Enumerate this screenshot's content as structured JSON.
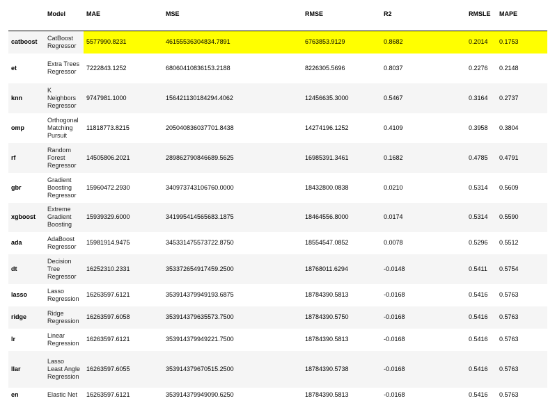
{
  "table": {
    "columns": [
      "",
      "Model",
      "MAE",
      "MSE",
      "RMSE",
      "R2",
      "RMSLE",
      "MAPE"
    ],
    "highlight_color": "#ffff00",
    "rows": [
      {
        "id": "catboost",
        "model": "CatBoost Regressor",
        "mae": "5577990.8231",
        "mse": "46155536304834.7891",
        "rmse": "6763853.9129",
        "r2": "0.8682",
        "rmsle": "0.2014",
        "mape": "0.1753"
      },
      {
        "id": "et",
        "model": "Extra Trees Regressor",
        "mae": "7222843.1252",
        "mse": "68060410836153.2188",
        "rmse": "8226305.5696",
        "r2": "0.8037",
        "rmsle": "0.2276",
        "mape": "0.2148"
      },
      {
        "id": "knn",
        "model": "K Neighbors Regressor",
        "mae": "9747981.1000",
        "mse": "156421130184294.4062",
        "rmse": "12456635.3000",
        "r2": "0.5467",
        "rmsle": "0.3164",
        "mape": "0.2737"
      },
      {
        "id": "omp",
        "model": "Orthogonal Matching Pursuit",
        "mae": "11818773.8215",
        "mse": "205040836037701.8438",
        "rmse": "14274196.1252",
        "r2": "0.4109",
        "rmsle": "0.3958",
        "mape": "0.3804"
      },
      {
        "id": "rf",
        "model": "Random Forest Regressor",
        "mae": "14505806.2021",
        "mse": "289862790846689.5625",
        "rmse": "16985391.3461",
        "r2": "0.1682",
        "rmsle": "0.4785",
        "mape": "0.4791"
      },
      {
        "id": "gbr",
        "model": "Gradient Boosting Regressor",
        "mae": "15960472.2930",
        "mse": "340973743106760.0000",
        "rmse": "18432800.0838",
        "r2": "0.0210",
        "rmsle": "0.5314",
        "mape": "0.5609"
      },
      {
        "id": "xgboost",
        "model": "Extreme Gradient Boosting",
        "mae": "15939329.6000",
        "mse": "341995414565683.1875",
        "rmse": "18464556.8000",
        "r2": "0.0174",
        "rmsle": "0.5314",
        "mape": "0.5590"
      },
      {
        "id": "ada",
        "model": "AdaBoost Regressor",
        "mae": "15981914.9475",
        "mse": "345331475573722.8750",
        "rmse": "18554547.0852",
        "r2": "0.0078",
        "rmsle": "0.5296",
        "mape": "0.5512"
      },
      {
        "id": "dt",
        "model": "Decision Tree Regressor",
        "mae": "16252310.2331",
        "mse": "353372654917459.2500",
        "rmse": "18768011.6294",
        "r2": "-0.0148",
        "rmsle": "0.5411",
        "mape": "0.5754"
      },
      {
        "id": "lasso",
        "model": "Lasso Regression",
        "mae": "16263597.6121",
        "mse": "353914379949193.6875",
        "rmse": "18784390.5813",
        "r2": "-0.0168",
        "rmsle": "0.5416",
        "mape": "0.5763"
      },
      {
        "id": "ridge",
        "model": "Ridge Regression",
        "mae": "16263597.6058",
        "mse": "353914379635573.7500",
        "rmse": "18784390.5750",
        "r2": "-0.0168",
        "rmsle": "0.5416",
        "mape": "0.5763"
      },
      {
        "id": "lr",
        "model": "Linear Regression",
        "mae": "16263597.6121",
        "mse": "353914379949221.7500",
        "rmse": "18784390.5813",
        "r2": "-0.0168",
        "rmsle": "0.5416",
        "mape": "0.5763"
      },
      {
        "id": "llar",
        "model": "Lasso Least Angle Regression",
        "mae": "16263597.6055",
        "mse": "353914379670515.2500",
        "rmse": "18784390.5738",
        "r2": "-0.0168",
        "rmsle": "0.5416",
        "mape": "0.5763"
      },
      {
        "id": "en",
        "model": "Elastic Net",
        "mae": "16263597.6121",
        "mse": "353914379949090.6250",
        "rmse": "18784390.5813",
        "r2": "-0.0168",
        "rmsle": "0.5416",
        "mape": "0.5763"
      }
    ]
  }
}
